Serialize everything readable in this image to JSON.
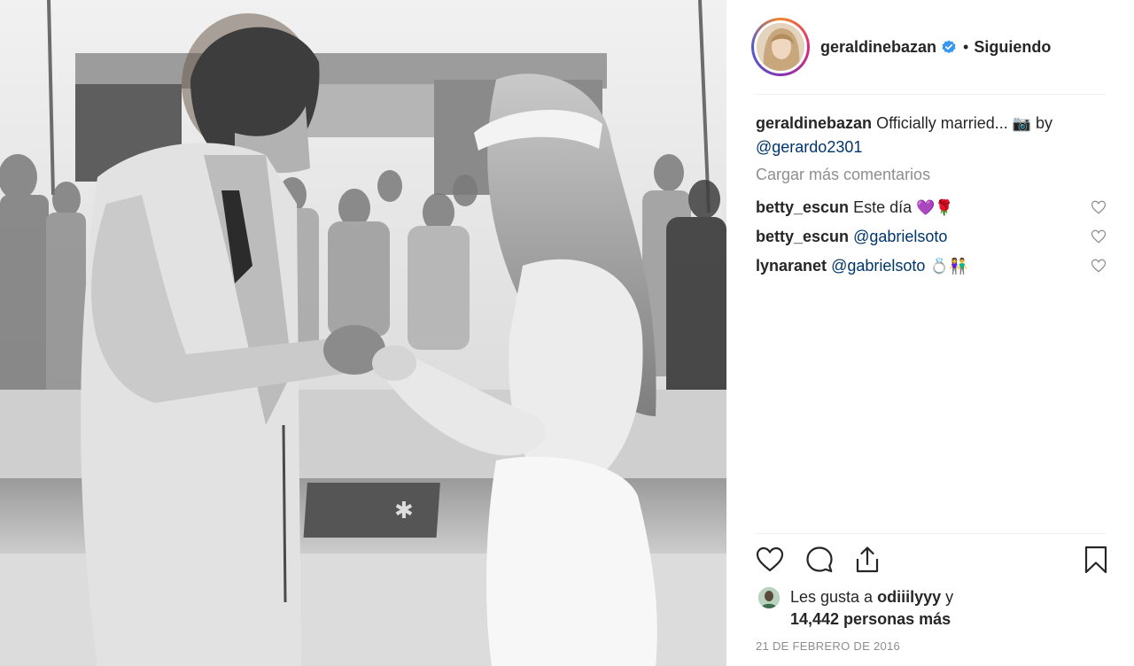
{
  "photo": {
    "alt_description_visible": false,
    "certificate_mark": "✱"
  },
  "post": {
    "username": "geraldinebazan",
    "follow_status": "Siguiendo",
    "separator_dot": "•",
    "caption_text": "Officially married... ",
    "caption_emoji": "📷",
    "caption_by": " by",
    "caption_mention": "@gerardo2301",
    "load_more": "Cargar más comentarios",
    "comments": [
      {
        "user": "betty_escun",
        "text": "Este día ",
        "mention": "",
        "emoji": "💜🌹"
      },
      {
        "user": "betty_escun",
        "text": "",
        "mention": "@gabrielsoto",
        "emoji": ""
      },
      {
        "user": "lynaranet",
        "text": "",
        "mention": "@gabrielsoto",
        "emoji": " 💍👫"
      }
    ],
    "likes": {
      "prefix": "Les gusta a ",
      "liker": "odiiilyyy",
      "suffix": " y",
      "line2": "14,442 personas más"
    },
    "date": "21 DE FEBRERO DE 2016"
  },
  "icons": {
    "like": "heart-outline-icon",
    "comment": "speech-bubble-icon",
    "share": "share-upload-icon",
    "save": "bookmark-icon",
    "verified": "verified-badge-icon"
  },
  "colors": {
    "text": "#262626",
    "muted": "#8e8e8e",
    "mention": "#003569",
    "verified": "#3897f0",
    "divider": "#efefef"
  }
}
